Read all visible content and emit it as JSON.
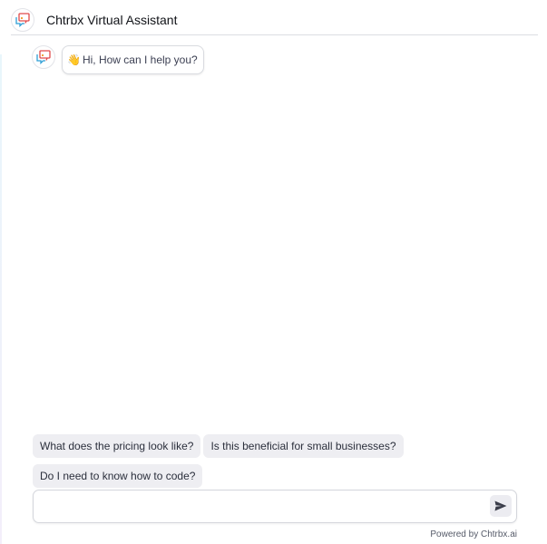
{
  "header": {
    "title": "Chtrbx Virtual Assistant",
    "logo_icon": "chat-bubbles-icon"
  },
  "conversation": {
    "greeting_emoji": "👋",
    "greeting_text": "Hi, How can I help you?"
  },
  "suggestions": [
    "What does the pricing look like?",
    "Is this beneficial for small businesses?",
    "Do I need to know how to code?"
  ],
  "composer": {
    "placeholder": "",
    "value": "",
    "send_icon": "send-icon"
  },
  "footer": {
    "text": "Powered by Chtrbx.ai"
  },
  "colors": {
    "logo_red": "#e04a4a",
    "logo_blue": "#2f9fd6",
    "logo_orange": "#f0a23a",
    "chip_bg": "#eeeef2"
  }
}
